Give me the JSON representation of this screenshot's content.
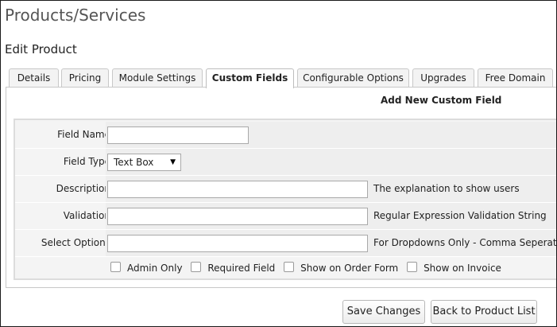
{
  "page": {
    "title": "Products/Services",
    "section": "Edit Product"
  },
  "tabs": [
    {
      "label": "Details"
    },
    {
      "label": "Pricing"
    },
    {
      "label": "Module Settings"
    },
    {
      "label": "Custom Fields",
      "active": true
    },
    {
      "label": "Configurable Options"
    },
    {
      "label": "Upgrades"
    },
    {
      "label": "Free Domain"
    }
  ],
  "form": {
    "heading": "Add New Custom Field",
    "field_name": {
      "label": "Field Name",
      "value": ""
    },
    "field_type": {
      "label": "Field Type",
      "selected": "Text Box"
    },
    "description": {
      "label": "Description",
      "value": "",
      "hint": "The explanation to show users"
    },
    "validation": {
      "label": "Validation",
      "value": "",
      "hint": "Regular Expression Validation String"
    },
    "select_options": {
      "label": "Select Options",
      "value": "",
      "hint": "For Dropdowns Only - Comma Seperated L"
    },
    "checkboxes": [
      {
        "label": "Admin Only",
        "checked": false
      },
      {
        "label": "Required Field",
        "checked": false
      },
      {
        "label": "Show on Order Form",
        "checked": false
      },
      {
        "label": "Show on Invoice",
        "checked": false
      }
    ]
  },
  "buttons": {
    "save": "Save Changes",
    "back": "Back to Product List"
  }
}
